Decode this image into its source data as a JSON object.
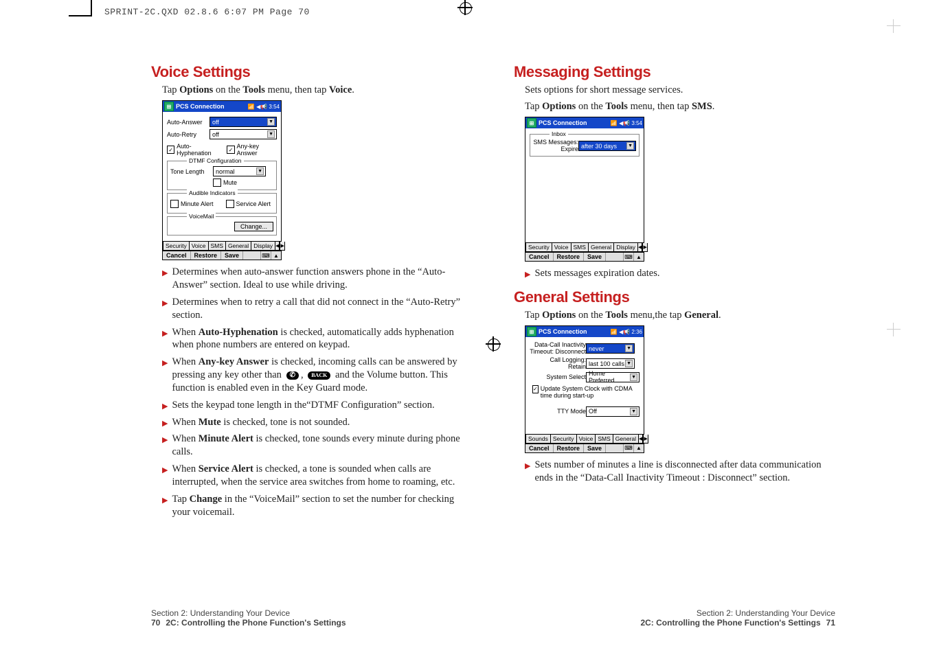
{
  "slug": "SPRINT-2C.QXD  02.8.6  6:07 PM  Page 70",
  "left": {
    "heading": "Voice Settings",
    "step_pre": "Tap ",
    "step_opt": "Options",
    "step_mid": " on the ",
    "step_tools": "Tools",
    "step_post": " menu, then tap ",
    "step_target": "Voice",
    "mock": {
      "title": "PCS Connection",
      "clock": "📶 ◀📢 3:54",
      "auto_answer_lbl": "Auto-Answer",
      "auto_answer_val": "off",
      "auto_retry_lbl": "Auto-Retry",
      "auto_retry_val": "off",
      "auto_hyph": "Auto-Hyphenation",
      "any_key": "Any-key Answer",
      "dtmf_legend": "DTMF Configuration",
      "tone_len_lbl": "Tone Length",
      "tone_len_val": "normal",
      "mute": "Mute",
      "ai_legend": "Audible Indicators",
      "min_alert": "Minute Alert",
      "svc_alert": "Service Alert",
      "vm_legend": "VoiceMail",
      "change_btn": "Change...",
      "tabs": [
        "Security",
        "Voice",
        "SMS",
        "General",
        "Display"
      ],
      "bottom": [
        "Cancel",
        "Restore",
        "Save"
      ]
    },
    "bullets": {
      "b1": "Determines when auto-answer function answers phone in the “Auto-Answer” section. Ideal to use while driving.",
      "b2": "Determines when to retry a call that did not connect in the “Auto-Retry” section.",
      "b3_pre": "When ",
      "b3_b": "Auto-Hyphenation",
      "b3_post": " is checked, automatically adds hyphenation when phone numbers are entered on keypad.",
      "b4_pre": "When ",
      "b4_b": "Any-key Answer",
      "b4_mid": " is checked, incoming calls can be answered by pressing any key other than ",
      "b4_back": "BACK",
      "b4_post": " and the Volume button. This function is enabled even in the Key Guard mode.",
      "b5": "Sets the keypad tone length in the“DTMF Configuration” section.",
      "b6_pre": "When ",
      "b6_b": "Mute",
      "b6_post": " is checked, tone is not sounded.",
      "b7_pre": "When ",
      "b7_b": "Minute Alert",
      "b7_post": " is checked, tone sounds every minute during phone calls.",
      "b8_pre": "When ",
      "b8_b": "Service Alert",
      "b8_post": " is checked, a tone is sounded when calls are interrupted, when the service area switches from home to roaming, etc.",
      "b9_pre": "Tap ",
      "b9_b": "Change",
      "b9_post": " in the “VoiceMail” section to set the number for checking your voicemail."
    },
    "footer_sect": "Section 2: Understanding Your Device",
    "footer_num": "70",
    "footer_sub": "2C: Controlling the Phone Function's Settings"
  },
  "right": {
    "h1": "Messaging Settings",
    "line1": "Sets options for short message services.",
    "step_pre": "Tap ",
    "step_opt": "Options",
    "step_mid": " on the ",
    "step_tools": "Tools",
    "step_post": " menu, then tap ",
    "step_target": "SMS",
    "mock_msg": {
      "title": "PCS Connection",
      "clock": "📶 ◀📢 3:54",
      "inbox_legend": "Inbox",
      "expire_lbl_1": "SMS Messages:",
      "expire_lbl_2": "Expire",
      "expire_val": "after 30 days",
      "tabs": [
        "Security",
        "Voice",
        "SMS",
        "General",
        "Display"
      ],
      "bottom": [
        "Cancel",
        "Restore",
        "Save"
      ]
    },
    "bullet_msg": "Sets messages expiration dates.",
    "h2": "General Settings",
    "step2_pre": "Tap ",
    "step2_opt": "Options",
    "step2_mid": " on the ",
    "step2_tools": "Tools",
    "step2_post": " menu,the tap ",
    "step2_target": "General",
    "mock_gen": {
      "title": "PCS Connection",
      "clock": "📶 ◀📢 2:36",
      "inact_lbl_1": "Data-Call Inactivity",
      "inact_lbl_2": "Timeout: Disconnect",
      "inact_val": "never",
      "log_lbl_1": "Call Logging:",
      "log_lbl_2": "Retain",
      "log_val": "last 100 calls",
      "sys_lbl": "System Select",
      "sys_val": "Home Preferred",
      "upd_ck": "Update System Clock with CDMA time during start-up",
      "tty_lbl": "TTY Mode",
      "tty_val": "Off",
      "tabs": [
        "Sounds",
        "Security",
        "Voice",
        "SMS",
        "General"
      ],
      "bottom": [
        "Cancel",
        "Restore",
        "Save"
      ]
    },
    "bullet_gen": "Sets number of minutes a line is disconnected after data communication ends in the “Data-Call Inactivity Timeout : Disconnect” section.",
    "footer_sect": "Section 2: Understanding Your Device",
    "footer_num": "71",
    "footer_sub": "2C: Controlling the Phone Function's Settings"
  }
}
